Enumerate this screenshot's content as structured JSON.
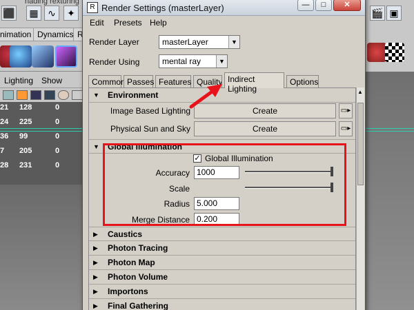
{
  "background": {
    "title_fragment": "nading    rexturing",
    "shelf_tabs": [
      "nimation",
      "Dynamics",
      "R"
    ],
    "panel_menu": [
      "Lighting",
      "Show"
    ],
    "table_rows": [
      {
        "id": "21",
        "val": "128",
        "z": "0"
      },
      {
        "id": "24",
        "val": "225",
        "z": "0"
      },
      {
        "id": "36",
        "val": "99",
        "z": "0"
      },
      {
        "id": "7",
        "val": "205",
        "z": "0"
      },
      {
        "id": "28",
        "val": "231",
        "z": "0"
      }
    ]
  },
  "window": {
    "title": "Render Settings (masterLayer)",
    "menus": [
      "Edit",
      "Presets",
      "Help"
    ],
    "render_layer_label": "Render Layer",
    "render_layer_value": "masterLayer",
    "render_using_label": "Render Using",
    "render_using_value": "mental ray",
    "tabs": [
      "Common",
      "Passes",
      "Features",
      "Quality",
      "Indirect Lighting",
      "Options"
    ],
    "active_tab": "Indirect Lighting"
  },
  "environment": {
    "title": "Environment",
    "ibl_label": "Image Based Lighting",
    "ibl_button": "Create",
    "sun_label": "Physical Sun and Sky",
    "sun_button": "Create"
  },
  "gi": {
    "title": "Global Illumination",
    "checkbox_label": "Global Illumination",
    "checked": true,
    "accuracy_label": "Accuracy",
    "accuracy_value": "1000",
    "scale_label": "Scale",
    "radius_label": "Radius",
    "radius_value": "5.000",
    "merge_label": "Merge Distance",
    "merge_value": "0.200"
  },
  "collapsed_sections": [
    "Caustics",
    "Photon Tracing",
    "Photon Map",
    "Photon Volume",
    "Importons",
    "Final Gathering"
  ],
  "colors": {
    "annotation_red": "#e8121b",
    "window_bg": "#d4d0c8",
    "maya_bg": "#6b6b6b"
  }
}
